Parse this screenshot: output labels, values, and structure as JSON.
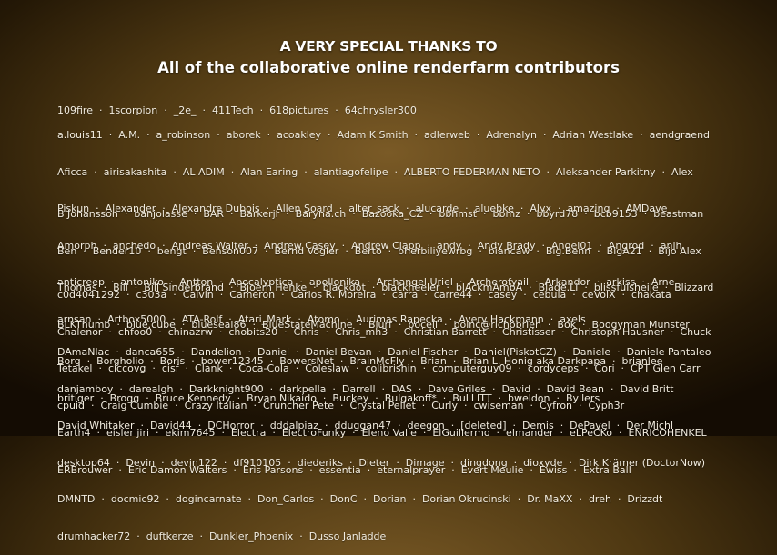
{
  "title": "A VERY SPECIAL THANKS TO",
  "subtitle": "All of the collaborative online renderfarm contributors",
  "groups": [
    {
      "lines": [
        "109fire  ·  1scorpion  ·  _2e_  ·  411Tech  ·  618pictures  ·  64chrysler300"
      ]
    },
    {
      "lines": [
        "a.louis11  ·  A.M.  ·  a_robinson  ·  aborek  ·  acoakley  ·  Adam K Smith  ·  adlerweb  ·  Adrenalyn  ·  Adrian Westlake  ·  aendgraend",
        "Aficca  ·  airisakashita  ·  AL ADIM  ·  Alan Earing  ·  alantiagofelipe  ·  ALBERTO FEDERMAN NETO  ·  Aleksander Parkitny  ·  Alex",
        "Piskun  ·  Alexander  ·  Alexandre Dubois  ·  Allen Soard  ·  alter_sack  ·  alucarde  ·  aluebke  ·  Alyx  ·  amazing  ·  AMDave",
        "Amorph  ·  anchedo  ·  Andreas Walter  ·  Andrew Casey  ·  Andrew Clapp  ·  andy  ·  Andy Brady  ·  Angel01  ·  Angrod  ·  anih",
        "anticreep  ·  antoniko  ·  Antton  ·  Apocalyptica  ·  apollonika  ·  Archangel Uriel  ·  Archerofyail  ·  Arkandor  ·  arkiss  ·  Arne",
        "arnsan  ·  Artbox5000  ·  ATA-Rolf  ·  Atari_Mark  ·  Atomo  ·  Aurimas Rapecka  ·  Avery Hackmann  ·  axels"
      ]
    },
    {
      "lines": [
        "B Johansson  ·  banjolasse  ·  BAR  ·  Barkerjr  ·  Baryna.ch  ·  Bazooka_CZ  ·  bbhmst  ·  bbmz  ·  bbyrd78  ·  bcb9153  ·  beastman",
        "Ben  ·  Bender10  ·  bengt  ·  Benson007  ·  Bernd Vogler  ·  Berto  ·  bherbiliyewrbg  ·  biancaw  ·  Big.Benn  ·  BigA21  ·  Bijo Alex",
        "Thomas  ·  Bill  ·  Bill Sinderbrand  ·  Bjoern Henke  ·  blackdot  ·  blackheeler  ·  blAckmAmbA  ·  Blade.Li  ·  blissfulsheile  ·  Blizzard",
        "BLKThumb  ·  blue.cube  ·  blueseal86  ·  BlueStateMachine  ·  Blurf  ·  boceli  ·  boinc@richobrien  ·  Bok  ·  Boogyman Munster",
        "Borg  ·  Borgholio  ·  Boris  ·  bower12345  ·  BowersNet  ·  BrainMcFly  ·  Brian  ·  Brian L. Honig aka Darkpapa  ·  brianlee",
        "britiger  ·  Brogg  ·  Bruce Kennedy  ·  Bryan Nikaido  ·  Buckey  ·  Bulgakoff*  ·  BuLLITT  ·  bweldon  ·  Byllers"
      ]
    },
    {
      "lines": [
        "c0d4041292  ·  c303a  ·  Calvin  ·  Cameron  ·  Carlos R. Moreira  ·  carra  ·  carre44  ·  casey  ·  cebula  ·  ceVolX  ·  chakata",
        "Chalenor  ·  chfoo0  ·  chinazrw  ·  chobits20  ·  Chris  ·  Chris_mh3  ·  Christian Barrett  ·  Christisser  ·  Christoph Hausner  ·  Chuck",
        "Tetakel  ·  ciccovg  ·  cisf  ·  Clank  ·  Coca-Cola  ·  Coleslaw  ·  colibrishin  ·  computerguy09  ·  cordyceps  ·  Cori  ·  CPT Glen Carr",
        "cpuid  ·  Craig Cumbie  ·  Crazy Italian  ·  Cruncher Pete  ·  Crystal Pellet  ·  Curly  ·  cwiseman  ·  Cyfron  ·  Cyph3r"
      ]
    },
    {
      "lines": [
        "DAmaNlac  ·  danca655  ·  Dandelion  ·  Daniel  ·  Daniel Bevan  ·  Daniel Fischer  ·  Daniel(PiskotCZ)  ·  Daniele  ·  Daniele Pantaleo",
        "danjamboy  ·  darealgh  ·  Darkknight900  ·  darkpella  ·  Darrell  ·  DAS  ·  Dave Griles  ·  David  ·  David Bean  ·  David Britt",
        "David Whitaker  ·  David44  ·  DCHorror  ·  dddalpiaz  ·  dduggan47  ·  deegon  ·  [deleted]  ·  Demis  ·  DePavel  ·  Der Michl",
        "desktop64  ·  Devin  ·  devin122  ·  df910105  ·  diederiks  ·  Dieter  ·  Dimage  ·  dingdong  ·  dioxyde  ·  Dirk Krämer (DoctorNow)",
        "DMNTD  ·  docmic92  ·  dogincarnate  ·  Don_Carlos  ·  DonC  ·  Dorian  ·  Dorian Okrucinski  ·  Dr. MaXX  ·  dreh  ·  Drizzdt",
        "drumhacker72  ·  duftkerze  ·  Dunkler_Phoenix  ·  Dusso Janladde"
      ]
    },
    {
      "lines": [
        "Earth4  ·  eisler jiri  ·  ekim7645  ·  Electra  ·  ElectroFunky  ·  Eleno Valle  ·  ElGuillermo  ·  elmander  ·  eLPeCKo  ·  ENRICOHENKEL",
        "ERBrouwer  ·  Eric Damon Walters  ·  Eris Parsons  ·  essentia  ·  eternalprayer  ·  Evert Meulie  ·  Ewiss  ·  Extra Ball"
      ]
    }
  ]
}
